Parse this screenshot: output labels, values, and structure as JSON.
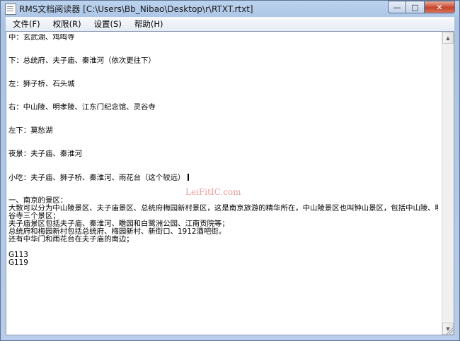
{
  "window": {
    "title": "RMS文档阅读器 [C:\\Users\\Bb_Nibao\\Desktop\\r\\RTXT.rtxt]",
    "icon": "document-icon",
    "controls": {
      "minimize": "—",
      "maximize": "□",
      "close": "✕"
    }
  },
  "menu": {
    "items": [
      "文件(F)",
      "权限(R)",
      "设置(S)",
      "帮助(H)"
    ]
  },
  "document": {
    "lines": [
      "中：玄武湖、鸡鸣寺",
      "",
      "",
      "下：总统府、夫子庙、秦淮河（依次更往下）",
      "",
      "",
      "左：狮子桥、石头城",
      "",
      "",
      "右：中山陵、明孝陵、江东门纪念馆、灵谷寺",
      "",
      "",
      "左下：莫愁湖",
      "",
      "",
      "夜景：夫子庙、秦淮河",
      "",
      "",
      "小吃：夫子庙、狮子桥、秦淮河、雨花台（这个较远）",
      "",
      "",
      "一、南京的景区：",
      "大致可以分为中山陵景区、夫子庙景区、总统府梅园新村景区，这是南京旅游的精华所在，中山陵景区也叫钟山景区，包括中山陵、明孝陵、灵",
      "谷寺三个景区；",
      "夫子庙景区包括夫子庙、秦淮河、瞻园和白鹭洲公园、江南贡院等；",
      "总统府和梅园新村包括总统府、梅园新村、新街口、1912酒吧街。",
      "还有中华门和雨花台在夫子庙的南边；",
      "",
      "G113",
      "G119"
    ],
    "caret_line": 18,
    "watermark": "LeiFitIC.com"
  },
  "scrollbar": {
    "up": "▲",
    "down": "▼"
  }
}
